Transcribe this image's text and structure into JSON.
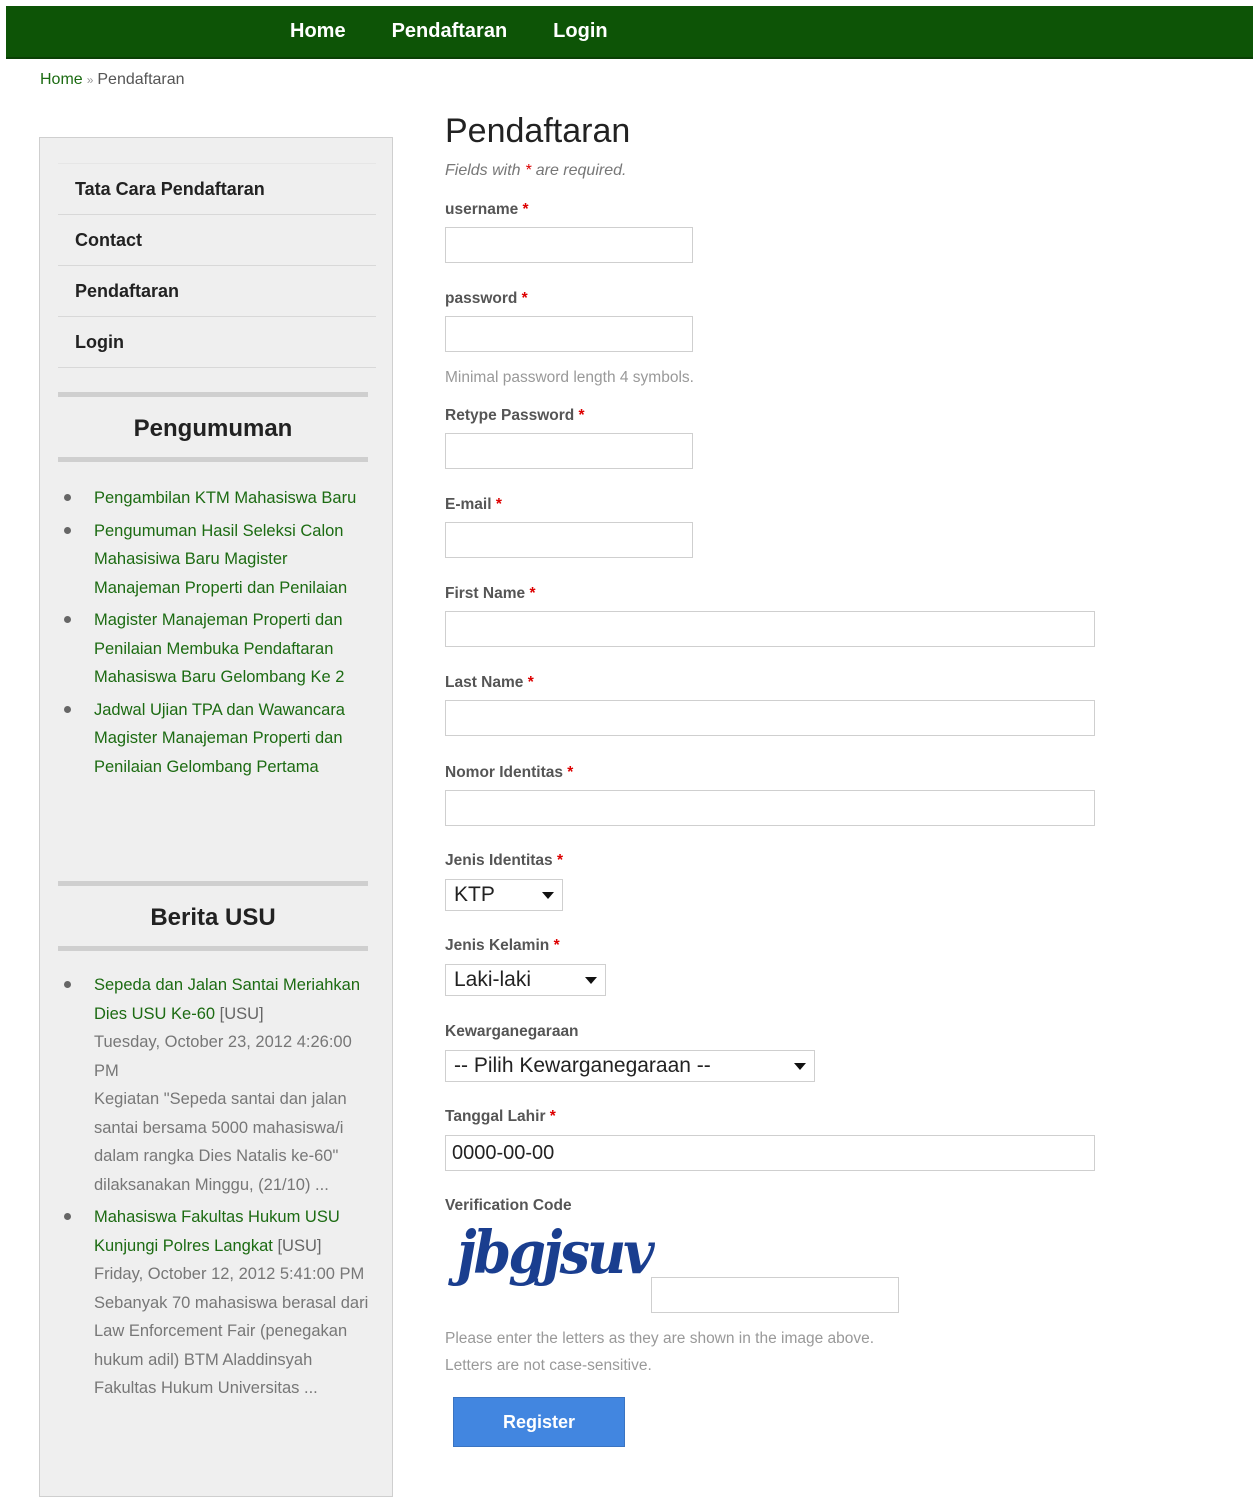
{
  "nav": {
    "home": "Home",
    "pendaftaran": "Pendaftaran",
    "login": "Login"
  },
  "breadcrumb": {
    "home": "Home",
    "sep": "»",
    "current": "Pendaftaran"
  },
  "sidebar": {
    "menu": [
      "Tata Cara Pendaftaran",
      "Contact",
      "Pendaftaran",
      "Login"
    ],
    "pengumuman_title": "Pengumuman",
    "pengumuman": [
      "Pengambilan KTM Mahasiswa Baru",
      "Pengumuman Hasil Seleksi Calon Mahasisiwa Baru Magister Manajeman Properti dan Penilaian",
      "Magister Manajeman Properti dan Penilaian Membuka Pendaftaran Mahasiswa Baru Gelombang Ke 2",
      "Jadwal Ujian TPA dan Wawancara Magister Manajeman Properti dan Penilaian Gelombang Pertama"
    ],
    "berita_title": "Berita USU",
    "berita": [
      {
        "title": "Sepeda dan Jalan Santai Meriahkan Dies USU Ke-60",
        "source": "[USU]",
        "date": "Tuesday, October 23, 2012 4:26:00 PM",
        "summary": "Kegiatan \"Sepeda santai dan jalan santai bersama 5000 mahasiswa/i dalam rangka Dies Natalis ke-60\" dilaksanakan Minggu, (21/10) ..."
      },
      {
        "title": "Mahasiswa Fakultas Hukum USU Kunjungi Polres Langkat",
        "source": "[USU]",
        "date": "Friday, October 12, 2012 5:41:00 PM",
        "summary": "Sebanyak 70 mahasiswa berasal dari Law Enforcement Fair (penegakan hukum adil) BTM Aladdinsyah Fakultas Hukum Universitas ..."
      }
    ]
  },
  "form": {
    "title": "Pendaftaran",
    "required_note_pre": "Fields with",
    "required_star": "*",
    "required_note_post": "are required.",
    "username_label": "username",
    "password_label": "password",
    "password_hint": "Minimal password length 4 symbols.",
    "retype_label": "Retype Password",
    "email_label": "E-mail",
    "firstname_label": "First Name",
    "lastname_label": "Last Name",
    "nomor_label": "Nomor Identitas",
    "jenis_identitas_label": "Jenis Identitas",
    "jenis_identitas_value": "KTP",
    "jenis_kelamin_label": "Jenis Kelamin",
    "jenis_kelamin_value": "Laki-laki",
    "kewarganegaraan_label": "Kewarganegaraan",
    "kewarganegaraan_value": "-- Pilih Kewarganegaraan --",
    "tanggal_label": "Tanggal Lahir",
    "tanggal_value": "0000-00-00",
    "verification_label": "Verification Code",
    "captcha_text": "jbgjsuv",
    "captcha_hint_1": "Please enter the letters as they are shown in the image above.",
    "captcha_hint_2": "Letters are not case-sensitive.",
    "register_label": "Register"
  },
  "colors": {
    "topbar": "#0d5406",
    "link": "#1c6b12",
    "button": "#4286e0",
    "required": "#dd0000"
  }
}
